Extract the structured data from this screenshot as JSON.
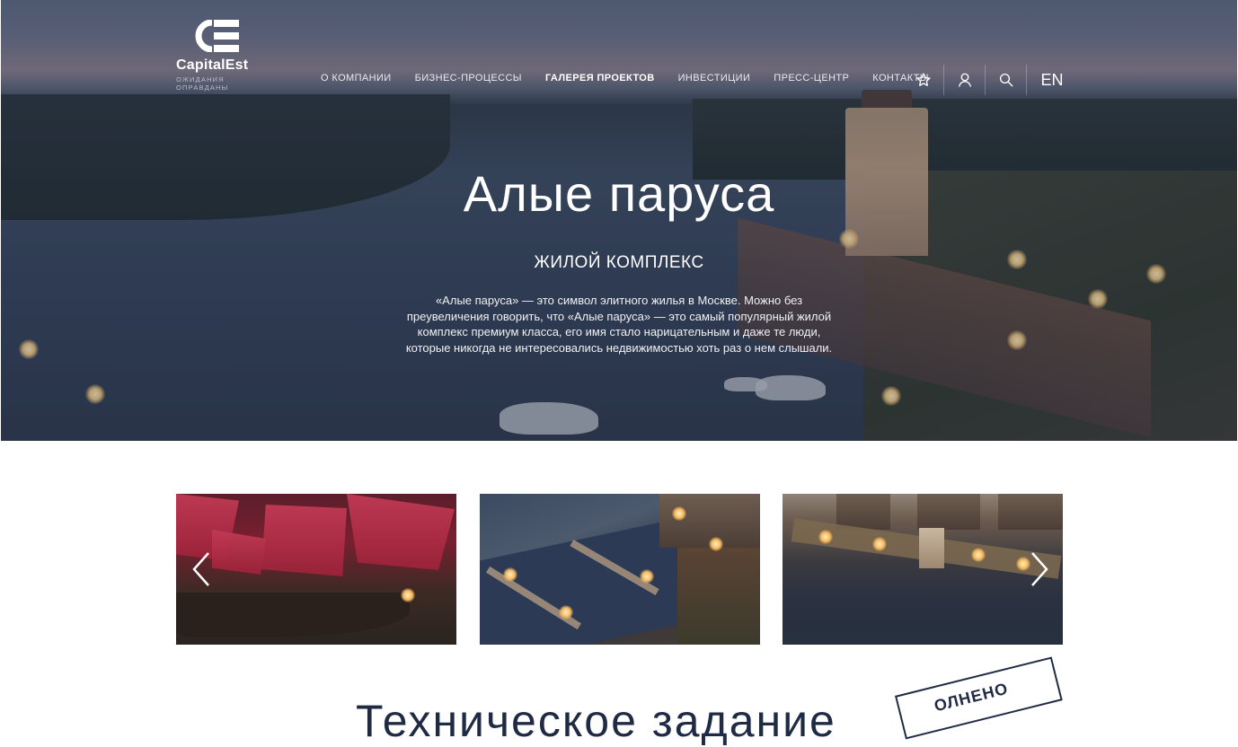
{
  "logo": {
    "brand": "CapitalEst",
    "tagline": "ОЖИДАНИЯ ОПРАВДАНЫ"
  },
  "nav": {
    "items": [
      {
        "label": "О КОМПАНИИ",
        "active": false
      },
      {
        "label": "БИЗНЕС-ПРОЦЕССЫ",
        "active": false
      },
      {
        "label": "ГАЛЕРЕЯ ПРОЕКТОВ",
        "active": true
      },
      {
        "label": "ИНВЕСТИЦИИ",
        "active": false
      },
      {
        "label": "ПРЕСС-ЦЕНТР",
        "active": false
      },
      {
        "label": "КОНТАКТЫ",
        "active": false
      }
    ],
    "tools": {
      "favorites_icon": "star-icon",
      "account_icon": "user-icon",
      "search_icon": "search-icon",
      "language": "EN"
    }
  },
  "hero": {
    "title": "Алые паруса",
    "subtitle": "ЖИЛОЙ КОМПЛЕКС",
    "description": "«Алые паруса» — это символ элитного жилья в Москве. Можно без преувеличения говорить, что «Алые паруса» — это самый популярный жилой комплекс премиум класса, его имя стало нарицательным и даже те люди, которые никогда не интересовались недвижимостью хоть раз о нем слышали."
  },
  "gallery": {
    "prev_icon": "chevron-left-icon",
    "next_icon": "chevron-right-icon"
  },
  "tech_task": {
    "title": "Техническое задание",
    "stamp": "ОЛНЕНО"
  }
}
